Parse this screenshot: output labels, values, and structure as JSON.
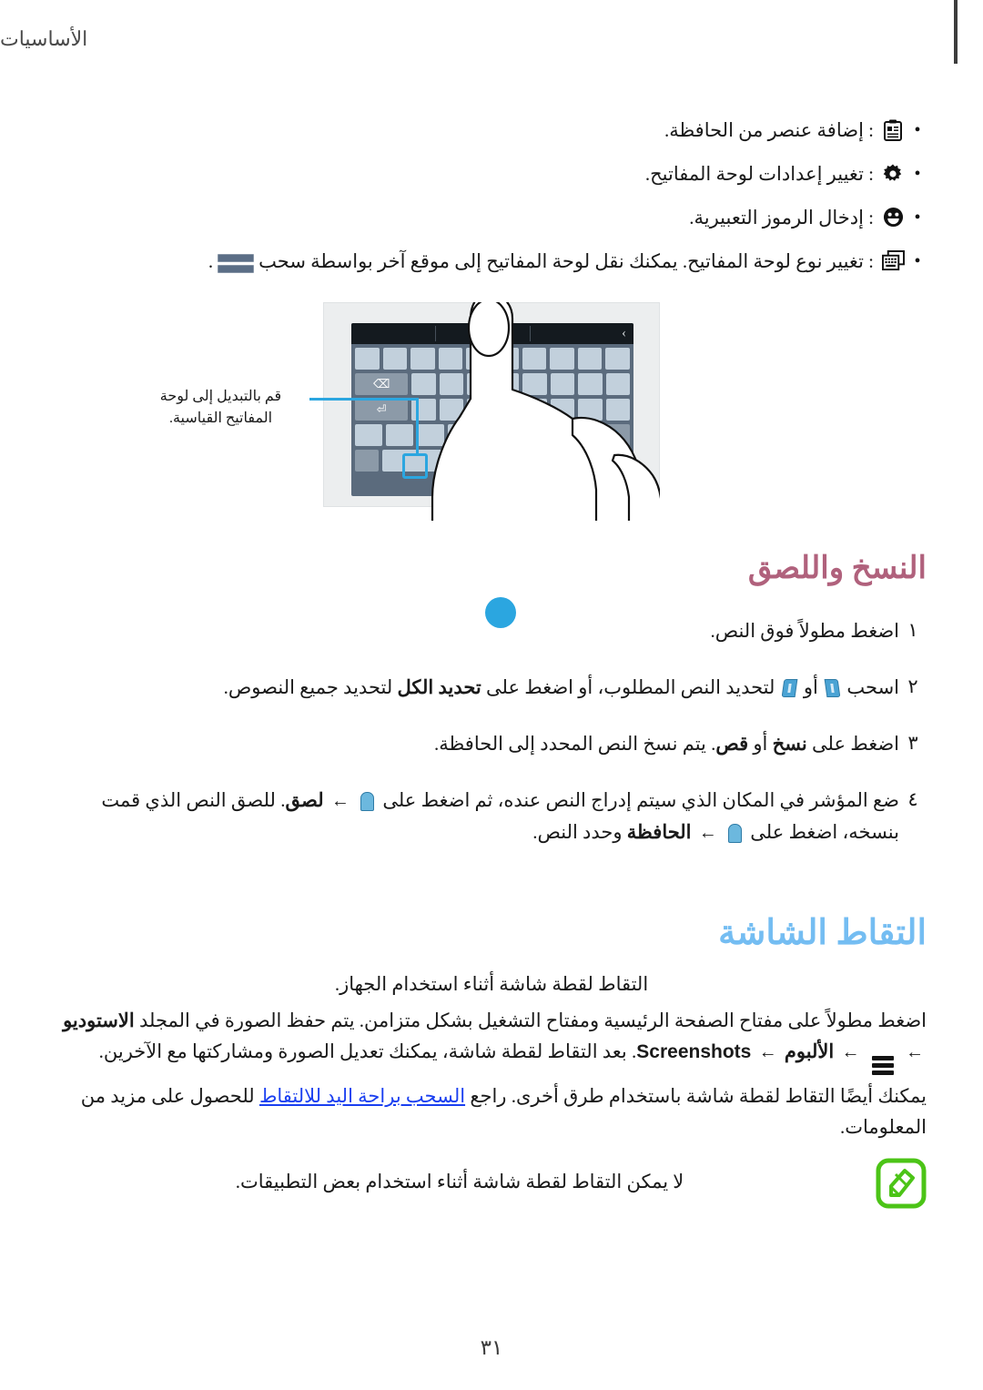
{
  "header": {
    "title": "الأساسيات",
    "edge_marker": "page-edge-tab"
  },
  "bullets": [
    {
      "icon": "clipboard-icon",
      "text": ": إضافة عنصر من الحافظة."
    },
    {
      "icon": "gear-icon",
      "text": ": تغيير إعدادات لوحة المفاتيح."
    },
    {
      "icon": "emoji-icon",
      "text": ": إدخال الرموز التعبيرية."
    },
    {
      "icon": "keyboard-icon",
      "text_before": ": تغيير نوع لوحة المفاتيح. يمكنك نقل لوحة المفاتيح إلى موقع آخر بواسطة سحب",
      "text_after": "."
    }
  ],
  "figure": {
    "name": "keyboard-switch-illustration",
    "callout": "قم بالتبديل إلى لوحة المفاتيح القياسية.",
    "suggestion_bar_chevron": "›",
    "backspace_glyph": "⌫",
    "enter_glyph": "⏎",
    "shift_glyph": "⬆",
    "keyboard_type_glyph": "⌨"
  },
  "copy_paste": {
    "heading": "النسخ واللصق",
    "steps": [
      {
        "num": "١",
        "parts": [
          {
            "type": "text",
            "value": "اضغط مطولاً فوق النص."
          }
        ]
      },
      {
        "num": "٢",
        "parts": [
          {
            "type": "text",
            "value": "اسحب"
          },
          {
            "type": "icon",
            "value": "selection-handle-right-icon"
          },
          {
            "type": "text",
            "value": "أو"
          },
          {
            "type": "icon",
            "value": "selection-handle-left-icon"
          },
          {
            "type": "text",
            "value": "لتحديد النص المطلوب، أو اضغط على"
          },
          {
            "type": "bold",
            "value": "تحديد الكل"
          },
          {
            "type": "text",
            "value": "لتحديد جميع النصوص."
          }
        ]
      },
      {
        "num": "٣",
        "parts": [
          {
            "type": "text",
            "value": "اضغط على"
          },
          {
            "type": "bold",
            "value": "نسخ"
          },
          {
            "type": "text",
            "value": "أو"
          },
          {
            "type": "bold",
            "value": "قص"
          },
          {
            "type": "text",
            "value": ". يتم نسخ النص المحدد إلى الحافظة."
          }
        ]
      },
      {
        "num": "٤",
        "parts": [
          {
            "type": "text",
            "value": "ضع المؤشر في المكان الذي سيتم إدراج النص عنده، ثم اضغط على"
          },
          {
            "type": "icon",
            "value": "cursor-pin-icon"
          },
          {
            "type": "arrow",
            "value": "←"
          },
          {
            "type": "bold",
            "value": "لصق"
          },
          {
            "type": "text",
            "value": ". للصق النص الذي قمت بنسخه، اضغط على"
          },
          {
            "type": "icon",
            "value": "cursor-pin-icon"
          },
          {
            "type": "arrow",
            "value": "←"
          },
          {
            "type": "bold",
            "value": "الحافظة"
          },
          {
            "type": "text",
            "value": "وحدد النص."
          }
        ]
      }
    ]
  },
  "screenshot": {
    "heading": "التقاط الشاشة",
    "intro": "التقاط لقطة شاشة أثناء استخدام الجهاز.",
    "body_1": "اضغط مطولاً على مفتاح الصفحة الرئيسية ومفتاح التشغيل بشكل متزامن. يتم حفظ الصورة في المجلد",
    "body_1_bold": "الاستوديو",
    "arrow": "←",
    "menu_icon": "hamburger-menu-icon",
    "body_2_bold_1": "الألبوم",
    "body_2_latin": "Screenshots",
    "body_2_tail": ". بعد التقاط لقطة شاشة، يمكنك تعديل الصورة ومشاركتها مع الآخرين.",
    "body_3_pre": "يمكنك أيضًا التقاط لقطة شاشة باستخدام طرق أخرى. راجع",
    "body_3_link": "السحب براحة اليد للالتقاط",
    "body_3_post": "للحصول على مزيد من المعلومات."
  },
  "note": {
    "icon": "note-pencil-icon",
    "icon_color": "#4cc417",
    "text": "لا يمكن التقاط لقطة شاشة أثناء استخدام بعض التطبيقات."
  },
  "footer": {
    "page_number": "٣١"
  }
}
